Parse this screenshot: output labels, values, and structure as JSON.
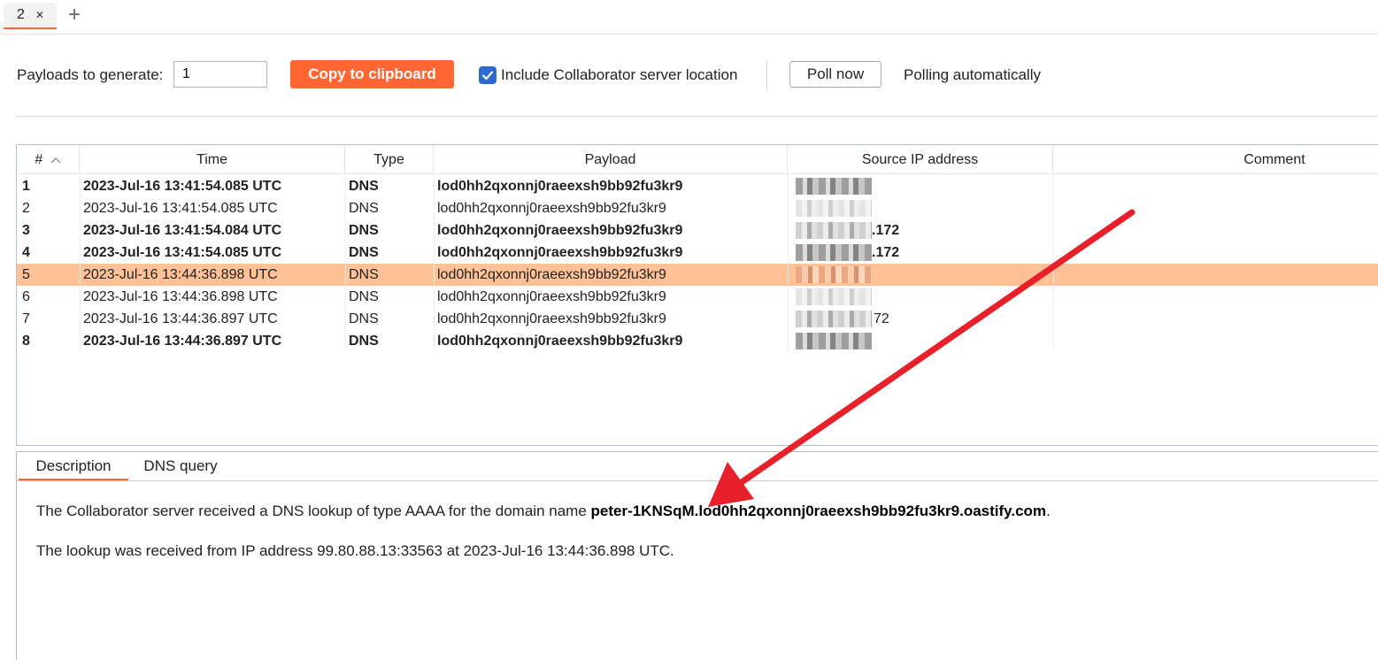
{
  "tabs": [
    {
      "label": "2",
      "close_icon": "close-icon"
    }
  ],
  "add_tab_icon": "plus-icon",
  "toolbar": {
    "payloads_label": "Payloads to generate:",
    "payloads_value": "1",
    "copy_label": "Copy to clipboard",
    "include_checked": true,
    "include_label": "Include Collaborator server location",
    "poll_label": "Poll now",
    "polling_status": "Polling automatically"
  },
  "table": {
    "headers": {
      "num": "#",
      "time": "Time",
      "type": "Type",
      "payload": "Payload",
      "source_ip": "Source IP address",
      "comment": "Comment"
    },
    "sort_icon": "sort-ascending-icon",
    "rows": [
      {
        "num": "1",
        "time": "2023-Jul-16 13:41:54.085 UTC",
        "type": "DNS",
        "payload": "lod0hh2qxonnj0raeexsh9bb92fu3kr9",
        "ip_visible": "",
        "bold": true,
        "selected": false
      },
      {
        "num": "2",
        "time": "2023-Jul-16 13:41:54.085 UTC",
        "type": "DNS",
        "payload": "lod0hh2qxonnj0raeexsh9bb92fu3kr9",
        "ip_visible": "",
        "bold": false,
        "selected": false
      },
      {
        "num": "3",
        "time": "2023-Jul-16 13:41:54.084 UTC",
        "type": "DNS",
        "payload": "lod0hh2qxonnj0raeexsh9bb92fu3kr9",
        "ip_visible": ".172",
        "bold": true,
        "selected": false
      },
      {
        "num": "4",
        "time": "2023-Jul-16 13:41:54.085 UTC",
        "type": "DNS",
        "payload": "lod0hh2qxonnj0raeexsh9bb92fu3kr9",
        "ip_visible": ".172",
        "bold": true,
        "selected": false
      },
      {
        "num": "5",
        "time": "2023-Jul-16 13:44:36.898 UTC",
        "type": "DNS",
        "payload": "lod0hh2qxonnj0raeexsh9bb92fu3kr9",
        "ip_visible": "",
        "bold": false,
        "selected": true
      },
      {
        "num": "6",
        "time": "2023-Jul-16 13:44:36.898 UTC",
        "type": "DNS",
        "payload": "lod0hh2qxonnj0raeexsh9bb92fu3kr9",
        "ip_visible": "",
        "bold": false,
        "selected": false
      },
      {
        "num": "7",
        "time": "2023-Jul-16 13:44:36.897 UTC",
        "type": "DNS",
        "payload": "lod0hh2qxonnj0raeexsh9bb92fu3kr9",
        "ip_visible": "72",
        "bold": false,
        "selected": false
      },
      {
        "num": "8",
        "time": "2023-Jul-16 13:44:36.897 UTC",
        "type": "DNS",
        "payload": "lod0hh2qxonnj0raeexsh9bb92fu3kr9",
        "ip_visible": "",
        "bold": true,
        "selected": false
      }
    ]
  },
  "detail": {
    "tabs": [
      {
        "label": "Description",
        "active": true
      },
      {
        "label": "DNS query",
        "active": false
      }
    ],
    "line1_prefix": "The Collaborator server received a DNS lookup of type AAAA for the domain name ",
    "line1_domain": "peter-1KNSqM.lod0hh2qxonnj0raeexsh9bb92fu3kr9.oastify.com",
    "line1_suffix": ".",
    "line2": "The lookup was received from IP address 99.80.88.13:33563 at 2023-Jul-16 13:44:36.898 UTC."
  },
  "colors": {
    "accent": "#ff6633",
    "selected_row": "#ffc195",
    "checkbox": "#2a6ad2",
    "annotation_arrow": "#e8202a"
  },
  "annotation_icon": "red-arrow-icon"
}
